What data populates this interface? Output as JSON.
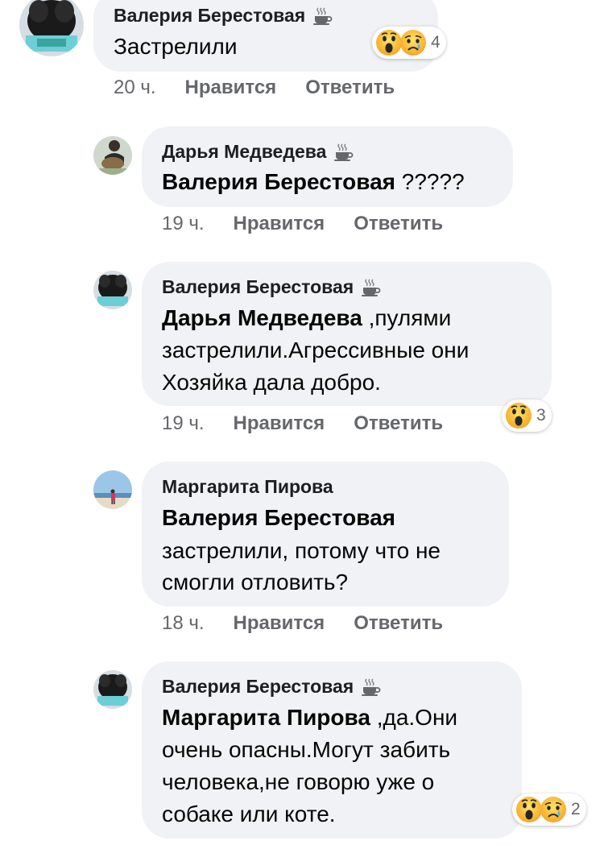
{
  "comments": [
    {
      "author": "Валерия Берестовая",
      "author_badge": "coffee-cup-icon",
      "text_lines": [
        "Застрелили"
      ],
      "time": "20 ч.",
      "like_label": "Нравится",
      "reply_label": "Ответить",
      "reactions": [
        "wow",
        "sad"
      ],
      "reaction_count": "4"
    },
    {
      "author": "Дарья Медведева",
      "author_badge": "coffee-cup-icon",
      "mention": "Валерия Берестовая",
      "text_after_mention": " ?????",
      "time": "19 ч.",
      "like_label": "Нравится",
      "reply_label": "Ответить"
    },
    {
      "author": "Валерия Берестовая",
      "author_badge": "coffee-cup-icon",
      "mention": "Дарья Медведева",
      "text_after_mention": " ,пулями",
      "text_lines": [
        "застрелили.Агрессивные  они",
        "Хозяйка дала добро."
      ],
      "time": "19 ч.",
      "like_label": "Нравится",
      "reply_label": "Ответить",
      "reactions": [
        "wow"
      ],
      "reaction_count": "3"
    },
    {
      "author": "Маргарита Пирова",
      "mention": "Валерия Берестовая",
      "text_lines": [
        "застрелили, потому что не",
        "смогли отловить?"
      ],
      "time": "18 ч.",
      "like_label": "Нравится",
      "reply_label": "Ответить"
    },
    {
      "author": "Валерия Берестовая",
      "author_badge": "coffee-cup-icon",
      "mention": "Маргарита Пирова",
      "text_after_mention": " ,да.Они",
      "text_lines": [
        "очень опасны.Могут забить",
        "человека,не говорю уже о",
        "собаке или коте."
      ],
      "reactions": [
        "wow",
        "sad"
      ],
      "reaction_count": "2"
    }
  ],
  "colors": {
    "bubble_bg": "#f0f2f5",
    "meta_text": "#65676b",
    "body_text": "#050505",
    "emoji_yellow": "#f7b125"
  }
}
